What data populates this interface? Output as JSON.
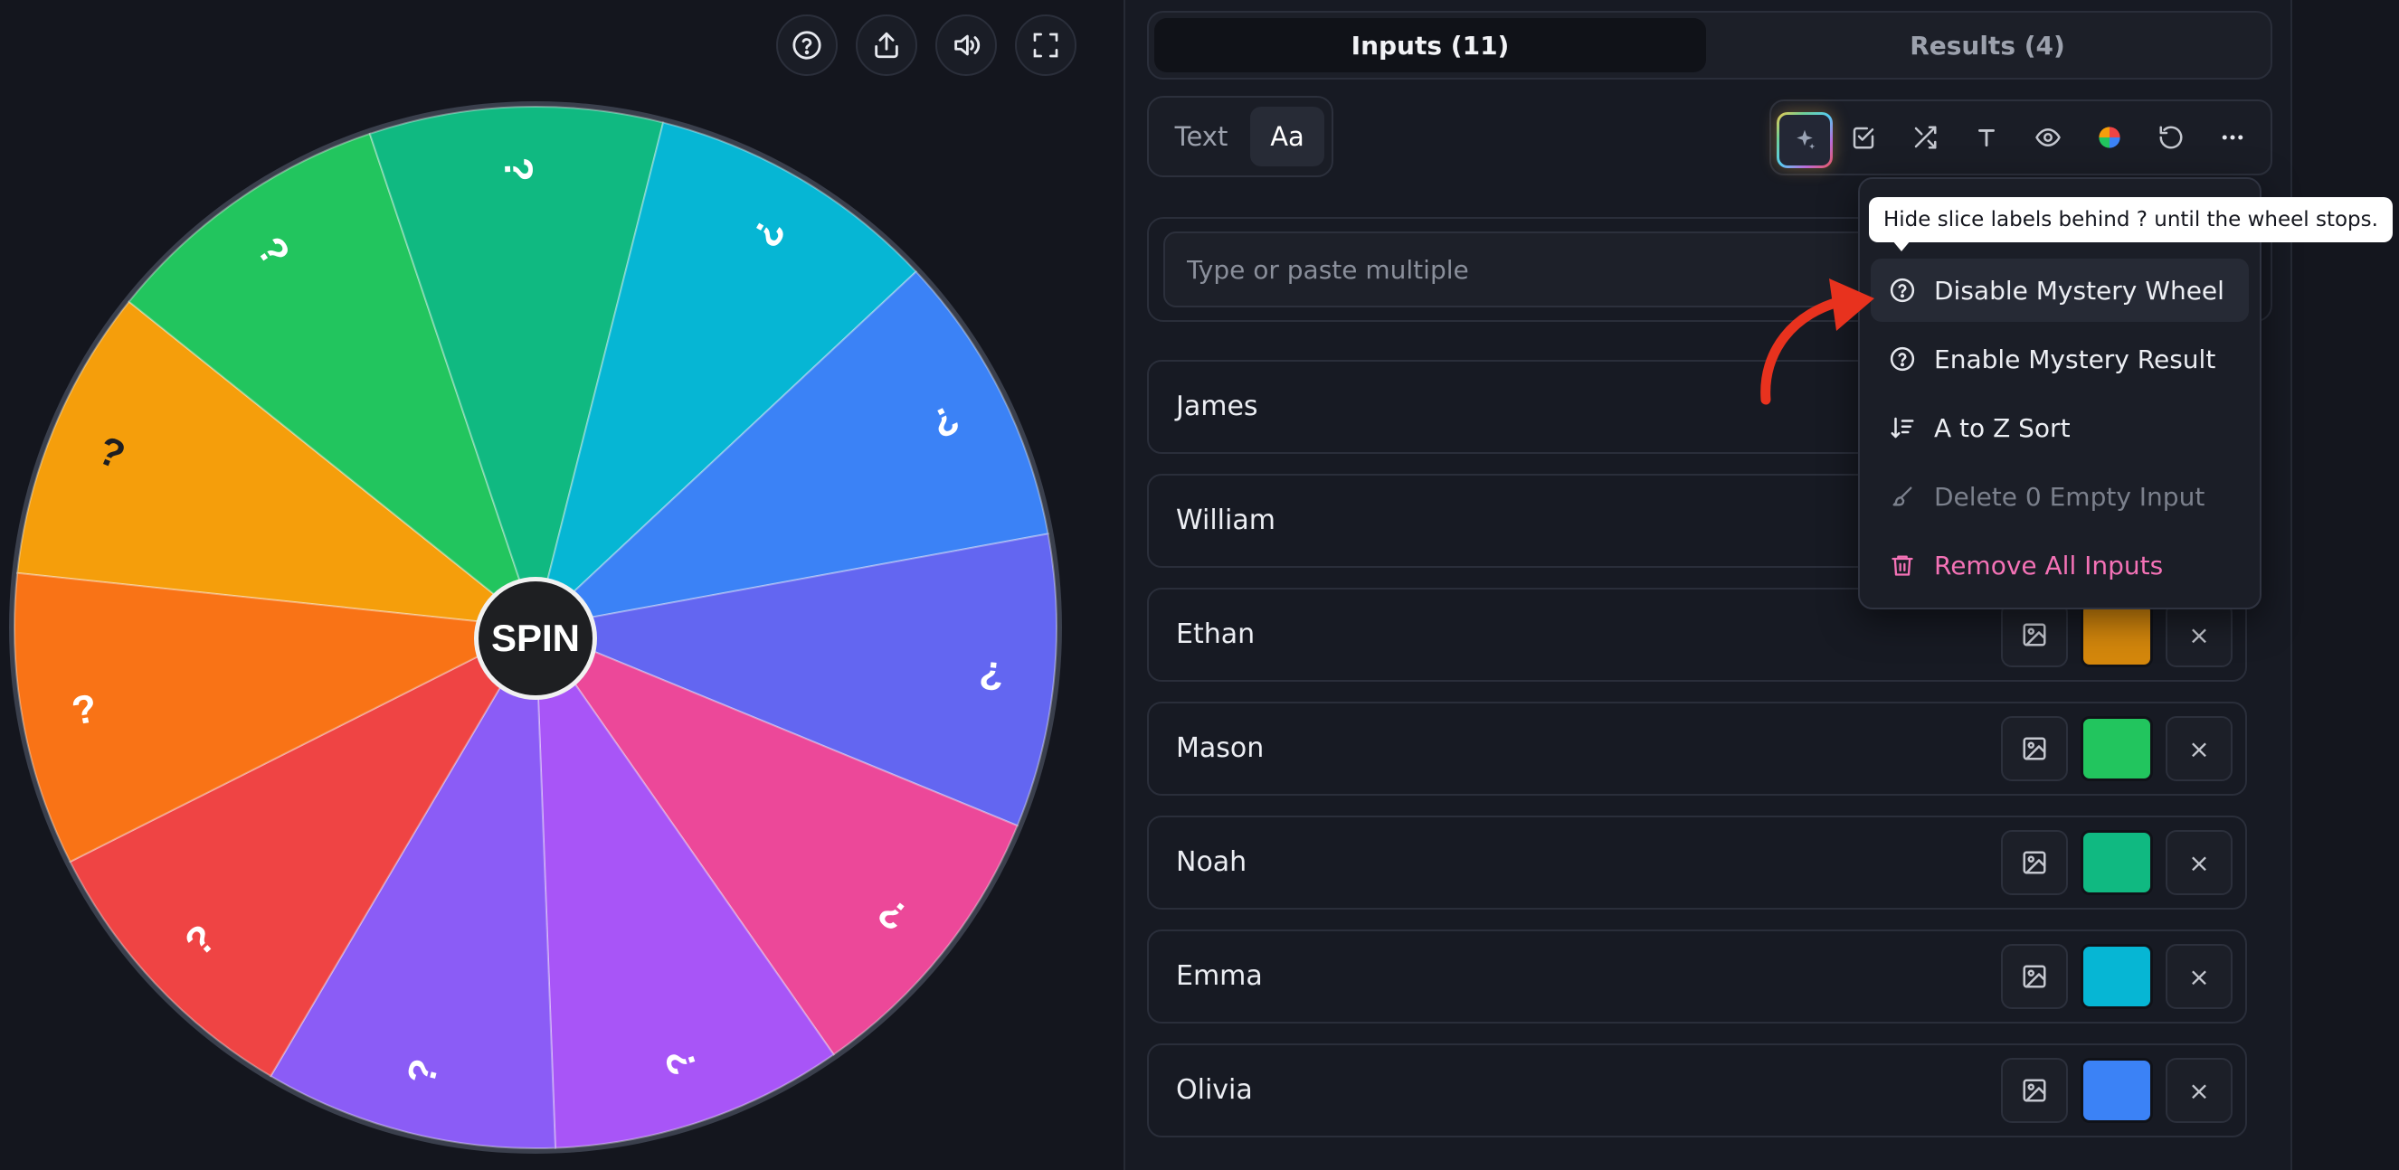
{
  "top_controls": [
    {
      "icon": "help-icon"
    },
    {
      "icon": "share-icon"
    },
    {
      "icon": "volume-icon"
    },
    {
      "icon": "fullscreen-icon"
    }
  ],
  "wheel": {
    "spin_label": "SPIN",
    "slices": [
      {
        "color": "#f59e0b",
        "label": "?"
      },
      {
        "color": "#22c55e",
        "label": "?"
      },
      {
        "color": "#10b981",
        "label": "?"
      },
      {
        "color": "#06b6d4",
        "label": "?"
      },
      {
        "color": "#3b82f6",
        "label": "?"
      },
      {
        "color": "#6366f1",
        "label": "?"
      },
      {
        "color": "#ec4899",
        "label": "?"
      },
      {
        "color": "#a855f7",
        "label": "?"
      },
      {
        "color": "#8b5cf6",
        "label": "?"
      },
      {
        "color": "#ef4444",
        "label": "?"
      },
      {
        "color": "#f97316",
        "label": "?"
      }
    ]
  },
  "tabs": {
    "inputs": "Inputs (11)",
    "results": "Results (4)"
  },
  "mode": {
    "text": "Text",
    "aa": "Aa"
  },
  "toolbar": [
    {
      "icon": "sparkle-icon"
    },
    {
      "icon": "checkbox-icon"
    },
    {
      "icon": "shuffle-icon"
    },
    {
      "icon": "text-icon"
    },
    {
      "icon": "eye-icon"
    },
    {
      "icon": "color-wheel-icon"
    },
    {
      "icon": "reset-icon"
    },
    {
      "icon": "more-icon"
    }
  ],
  "paste": {
    "placeholder": "Type or paste multiple"
  },
  "entries": [
    {
      "name": "James",
      "color": ""
    },
    {
      "name": "William",
      "color": ""
    },
    {
      "name": "Ethan",
      "color": "#d4870c"
    },
    {
      "name": "Mason",
      "color": "#22c55e"
    },
    {
      "name": "Noah",
      "color": "#10b981"
    },
    {
      "name": "Emma",
      "color": "#06b6d4"
    },
    {
      "name": "Olivia",
      "color": "#3b82f6"
    }
  ],
  "delete_symbol": "×",
  "menu": {
    "tooltip": "Hide slice labels behind ? until the wheel stops.",
    "items": [
      {
        "label": "Disable Mystery Wheel",
        "icon": "question-circle-icon"
      },
      {
        "label": "Enable Mystery Result",
        "icon": "question-circle-icon"
      },
      {
        "label": "A to Z Sort",
        "icon": "sort-icon"
      },
      {
        "label": "Delete 0 Empty Input",
        "icon": "brush-icon"
      },
      {
        "label": "Remove All Inputs",
        "icon": "trash-icon"
      }
    ]
  },
  "colors": {
    "annotation_arrow": "#e8321e",
    "danger": "#f472b6"
  }
}
